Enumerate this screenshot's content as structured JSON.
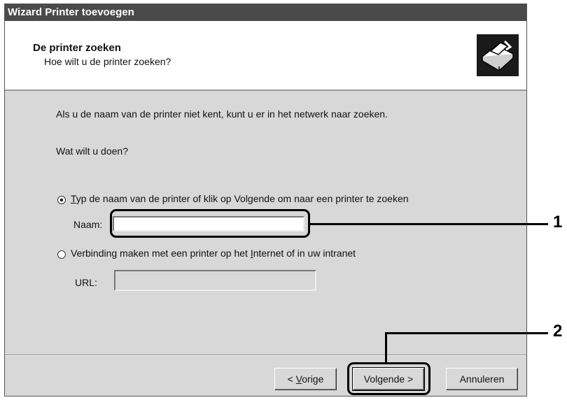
{
  "window": {
    "title": "Wizard Printer toevoegen"
  },
  "header": {
    "title": "De printer zoeken",
    "subtitle": "Hoe wilt u de printer zoeken?",
    "icon": "printer-wizard-icon"
  },
  "body": {
    "intro": "Als u de naam van de printer niet kent, kunt u er in het netwerk naar zoeken.",
    "question": "Wat wilt u doen?"
  },
  "options": {
    "type_name": {
      "accel": "T",
      "rest": "yp de naam van de printer of klik op Volgende om naar een printer te zoeken",
      "checked": true,
      "name_label": "Naam:",
      "name_value": ""
    },
    "internet": {
      "before": "Verbinding maken met een printer op het ",
      "accel": "I",
      "after": "nternet of in uw intranet",
      "checked": false,
      "url_label": "URL:",
      "url_value": ""
    }
  },
  "buttons": {
    "back": {
      "prefix": "< ",
      "accel": "V",
      "rest": "orige"
    },
    "next": {
      "label": "Volgende >"
    },
    "cancel": {
      "label": "Annuleren"
    }
  },
  "callouts": [
    "1",
    "2"
  ]
}
